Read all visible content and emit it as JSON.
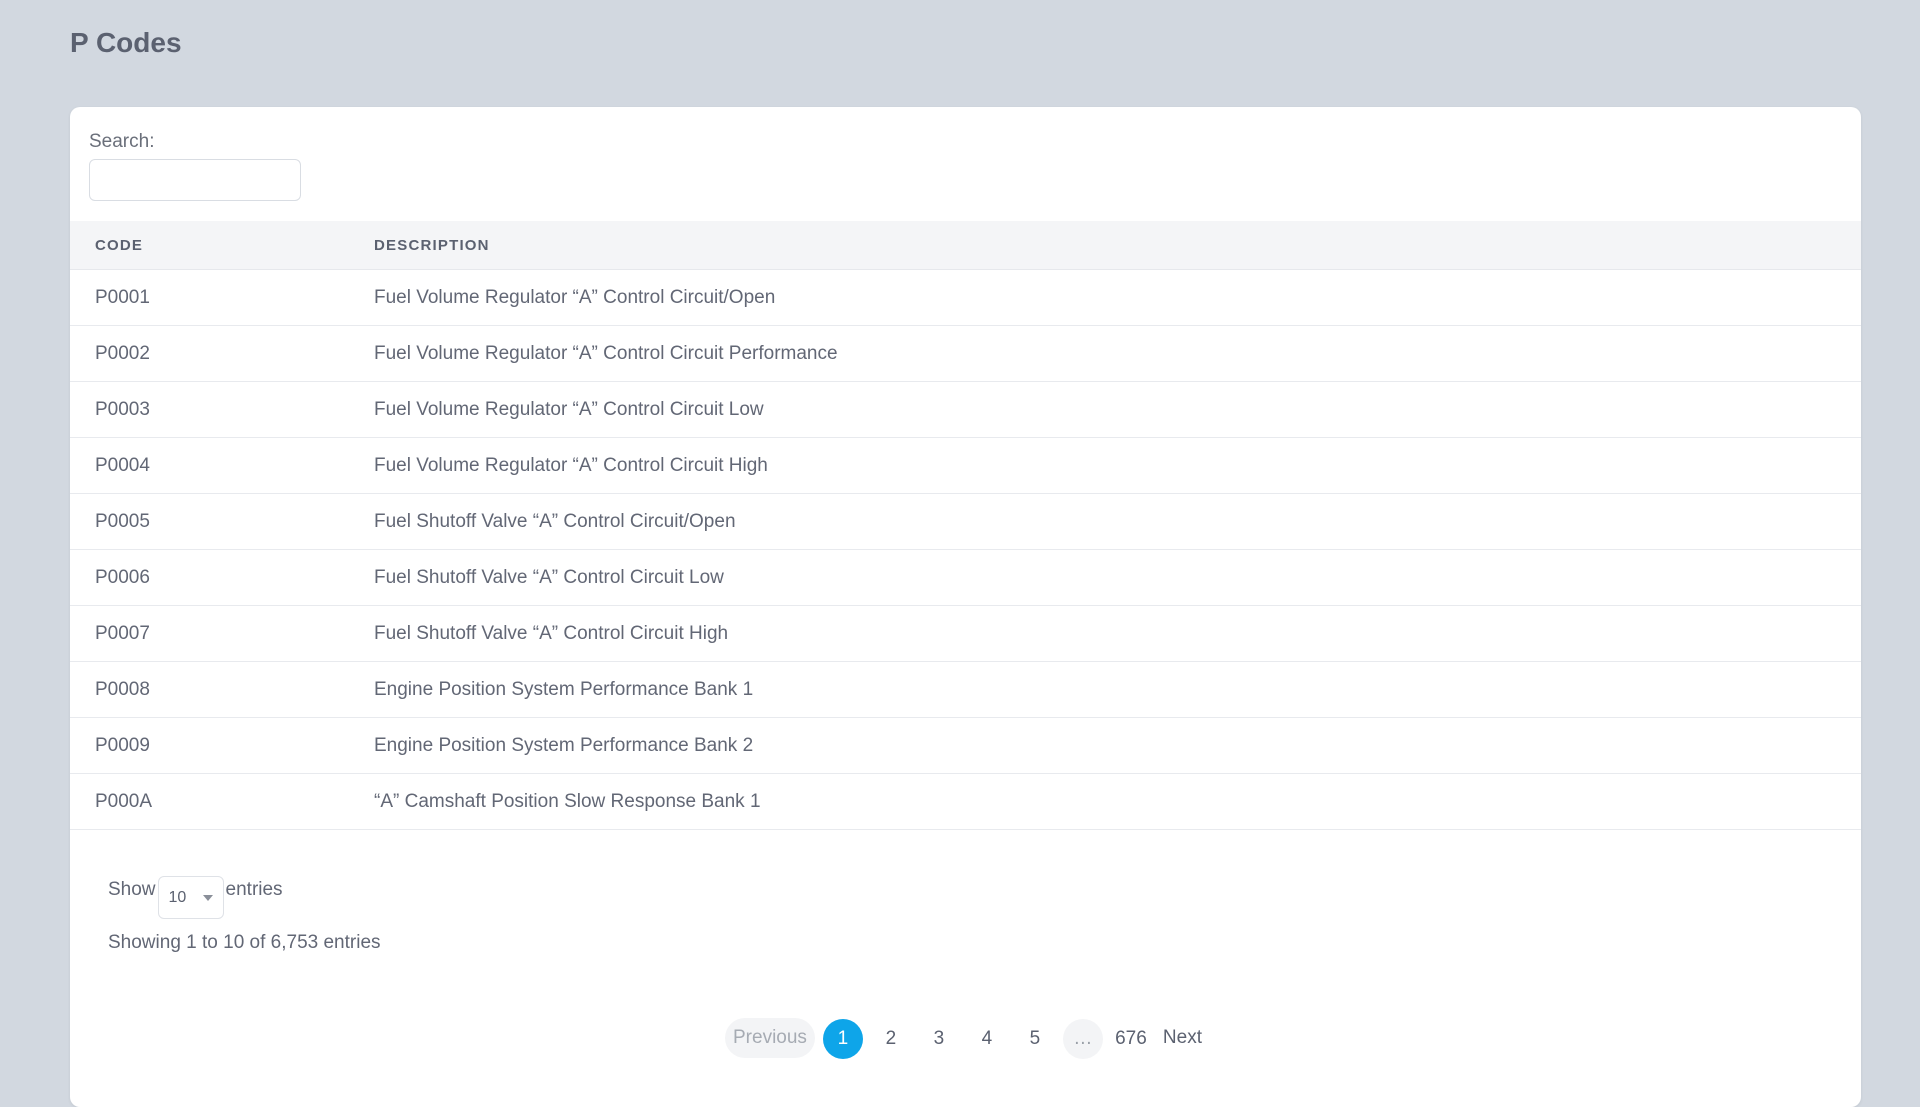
{
  "page": {
    "title": "P Codes"
  },
  "search": {
    "label": "Search:",
    "value": "",
    "placeholder": ""
  },
  "table": {
    "columns": [
      "CODE",
      "DESCRIPTION"
    ],
    "rows": [
      {
        "code": "P0001",
        "description": "Fuel Volume Regulator “A” Control Circuit/Open"
      },
      {
        "code": "P0002",
        "description": "Fuel Volume Regulator “A” Control Circuit Performance"
      },
      {
        "code": "P0003",
        "description": "Fuel Volume Regulator “A” Control Circuit Low"
      },
      {
        "code": "P0004",
        "description": "Fuel Volume Regulator “A” Control Circuit High"
      },
      {
        "code": "P0005",
        "description": "Fuel Shutoff Valve “A” Control Circuit/Open"
      },
      {
        "code": "P0006",
        "description": "Fuel Shutoff Valve “A” Control Circuit Low"
      },
      {
        "code": "P0007",
        "description": "Fuel Shutoff Valve “A” Control Circuit High"
      },
      {
        "code": "P0008",
        "description": "Engine Position System Performance Bank 1"
      },
      {
        "code": "P0009",
        "description": "Engine Position System Performance Bank 2"
      },
      {
        "code": "P000A",
        "description": "“A” Camshaft Position Slow Response Bank 1"
      }
    ]
  },
  "length": {
    "prefix": "Show",
    "selected": "10",
    "suffix": "entries"
  },
  "info": {
    "text": "Showing 1 to 10 of 6,753 entries"
  },
  "pagination": {
    "previous": "Previous",
    "pages": [
      "1",
      "2",
      "3",
      "4",
      "5"
    ],
    "ellipsis": "…",
    "last": "676",
    "next": "Next",
    "current": "1"
  },
  "colors": {
    "background": "#d2d8e0",
    "card": "#ffffff",
    "accent": "#0ea5e9",
    "text": "#626775"
  }
}
